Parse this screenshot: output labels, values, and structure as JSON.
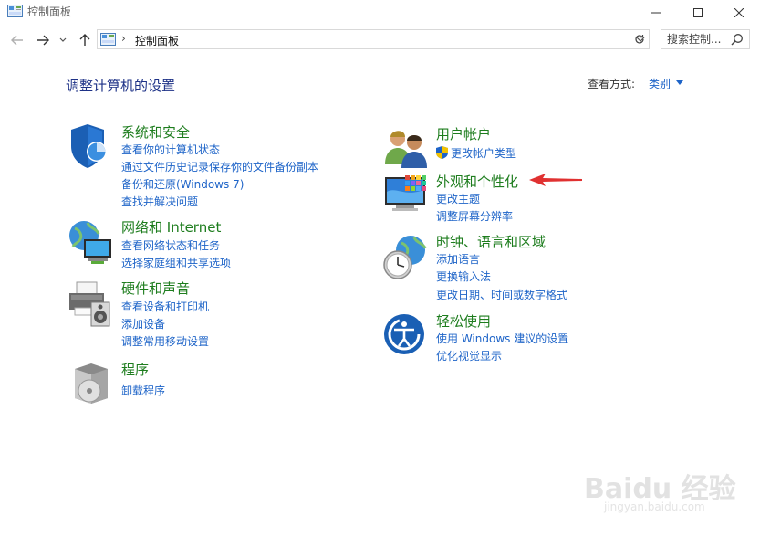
{
  "window": {
    "title": "控制面板"
  },
  "nav": {
    "breadcrumb": "控制面板",
    "search_placeholder": "搜索控制..."
  },
  "content": {
    "heading": "调整计算机的设置",
    "view_by_label": "查看方式:",
    "view_by_value": "类别"
  },
  "left_categories": [
    {
      "title": "系统和安全",
      "icon": "shield-icon",
      "links": [
        "查看你的计算机状态",
        "通过文件历史记录保存你的文件备份副本",
        "备份和还原(Windows 7)",
        "查找并解决问题"
      ]
    },
    {
      "title": "网络和 Internet",
      "icon": "network-icon",
      "links": [
        "查看网络状态和任务",
        "选择家庭组和共享选项"
      ]
    },
    {
      "title": "硬件和声音",
      "icon": "printer-icon",
      "links": [
        "查看设备和打印机",
        "添加设备",
        "调整常用移动设置"
      ]
    },
    {
      "title": "程序",
      "icon": "programs-icon",
      "links": [
        "卸载程序"
      ]
    }
  ],
  "right_categories": [
    {
      "title": "用户帐户",
      "icon": "users-icon",
      "links": [
        "更改帐户类型"
      ]
    },
    {
      "title": "外观和个性化",
      "icon": "monitor-icon",
      "links": [
        "更改主题",
        "调整屏幕分辨率"
      ]
    },
    {
      "title": "时钟、语言和区域",
      "icon": "clock-globe-icon",
      "links": [
        "添加语言",
        "更换输入法",
        "更改日期、时间或数字格式"
      ]
    },
    {
      "title": "轻松使用",
      "icon": "ease-of-access-icon",
      "links": [
        "使用 Windows 建议的设置",
        "优化视觉显示"
      ]
    }
  ],
  "watermark": {
    "brand": "Baidu 经验",
    "url": "jingyan.baidu.com"
  },
  "colors": {
    "category_title": "#1e7d1e",
    "link": "#1e64c8",
    "heading": "#1e3287",
    "annotation_arrow": "#e03131"
  }
}
